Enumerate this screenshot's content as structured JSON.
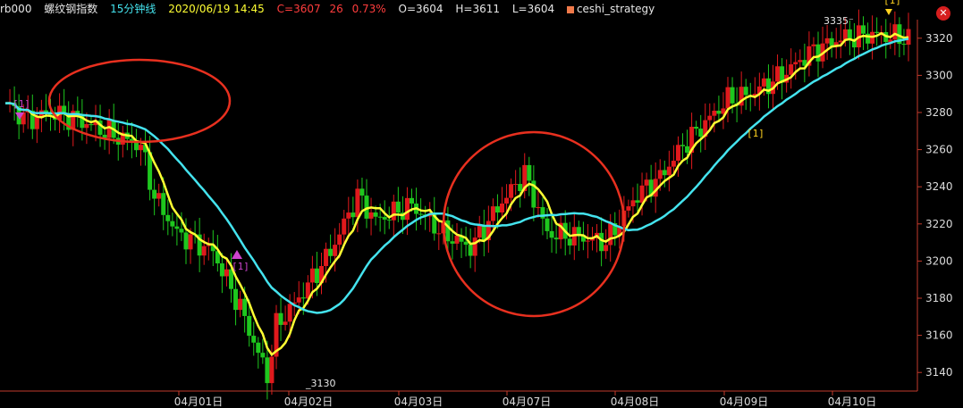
{
  "header": {
    "symbol": "rb000",
    "name": "螺纹钢指数",
    "period": "15分钟线",
    "datetime": "2020/06/19 14:45",
    "close": "C=3607",
    "change": "26",
    "change_pct": "0.73%",
    "open": "O=3604",
    "high": "H=3611",
    "low": "L=3604",
    "strategy": "ceshi_strategy"
  },
  "colors": {
    "background": "#000000",
    "up_candle": "#e0191c",
    "down_candle": "#1ec71e",
    "ma_fast": "#ffff33",
    "ma_slow": "#44e3ee",
    "circle": "#e8301f",
    "axis": "#c23a2b",
    "signal": "#cc44cc"
  },
  "chart_data": {
    "type": "candlestick",
    "ylim": [
      3130,
      3330
    ],
    "y_ticks": [
      3140,
      3160,
      3180,
      3200,
      3220,
      3240,
      3260,
      3280,
      3300,
      3320
    ],
    "x_ticks": [
      "04月01日",
      "04月02日",
      "04月03日",
      "04月07日",
      "04月08日",
      "04月09日",
      "04月10日"
    ],
    "annotations": {
      "low_label": "3130",
      "high_label": "3335",
      "signal_label": "[1]"
    },
    "series": [
      {
        "name": "fast",
        "color": "#ffff33"
      },
      {
        "name": "slow",
        "color": "#44e3ee"
      }
    ]
  }
}
